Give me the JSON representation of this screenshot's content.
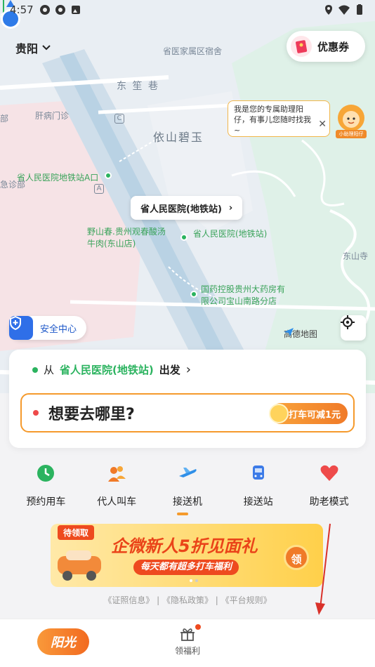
{
  "status_bar": {
    "time": "4:57"
  },
  "header": {
    "city": "贵阳",
    "coupon_label": "优惠券"
  },
  "map": {
    "labels": {
      "hospital_dorm": "省医家属区宿舍",
      "dongsheng_lane": "东 笙 巷",
      "gan_clinic": "肝病门诊",
      "yishan_biyu": "依山碧玉",
      "metro_exit_a": "省人民医院地铁站A口",
      "emergency": "急诊部",
      "bu": "部",
      "restaurant": "野山春.贵州观春酸汤\n牛肉(东山店)",
      "station_small": "省人民医院(地铁站)",
      "pharmacy": "国药控股贵州大药房有\n限公司宝山南路分店",
      "dongshan_temple": "东山寺",
      "badge_c": "C",
      "badge_a": "A"
    },
    "pickup_callout": "省人民医院(地铁站)",
    "amap_logo": "高德地图",
    "safety_center": "安全中心"
  },
  "assistant": {
    "message": "我是您的专属助理阳仔，有事儿您随时找我~",
    "tag": "小助理阳仔"
  },
  "booking": {
    "from_prefix": "从",
    "from_station": "省人民医院(地铁站)",
    "from_suffix": "出发",
    "destination_placeholder": "想要去哪里?",
    "discount": "打车可减1元"
  },
  "services": [
    {
      "label": "预约用车",
      "icon": "clock-icon",
      "color": "#2bb35f"
    },
    {
      "label": "代人叫车",
      "icon": "people-icon",
      "color": "#f07a28"
    },
    {
      "label": "接送机",
      "icon": "airplane-icon",
      "color": "#2f8fe8"
    },
    {
      "label": "接送站",
      "icon": "train-icon",
      "color": "#3c7be8"
    },
    {
      "label": "助老模式",
      "icon": "heart-icon",
      "color": "#ee4a4a"
    }
  ],
  "banner": {
    "tag": "待领取",
    "title": "企微新人5折见面礼",
    "subtitle": "每天都有超多打车福利",
    "claim": "领"
  },
  "legal": "《证照信息》 | 《隐私政策》 | 《平台规则》",
  "tab_bar": {
    "home_label": "阳光",
    "benefits_label": "领福利"
  },
  "colors": {
    "accent": "#f59a2c",
    "green": "#2bb35f",
    "red": "#ee4a4a"
  }
}
